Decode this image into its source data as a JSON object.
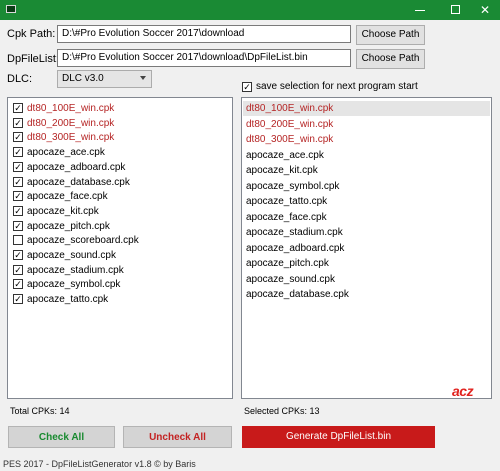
{
  "titlebar": {
    "minimize": "—",
    "maximize": "□",
    "close": "✕"
  },
  "cpk_path": {
    "label": "Cpk Path:",
    "value": "D:\\#Pro Evolution Soccer 2017\\download",
    "button": "Choose Path"
  },
  "dpfilelist": {
    "label": "DpFileList:",
    "value": "D:\\#Pro Evolution Soccer 2017\\download\\DpFileList.bin",
    "button": "Choose Path"
  },
  "dlc": {
    "label": "DLC:",
    "selected": "DLC v3.0"
  },
  "save_selection": {
    "label": "save selection for next program start",
    "checked": true
  },
  "left_list": [
    {
      "name": "dt80_100E_win.cpk",
      "checked": "✓",
      "red": true
    },
    {
      "name": "dt80_200E_win.cpk",
      "checked": "✓",
      "red": true
    },
    {
      "name": "dt80_300E_win.cpk",
      "checked": "✓",
      "red": true
    },
    {
      "name": "apocaze_ace.cpk",
      "checked": "✓",
      "red": false
    },
    {
      "name": "apocaze_adboard.cpk",
      "checked": "✓",
      "red": false
    },
    {
      "name": "apocaze_database.cpk",
      "checked": "✓",
      "red": false
    },
    {
      "name": "apocaze_face.cpk",
      "checked": "✓",
      "red": false
    },
    {
      "name": "apocaze_kit.cpk",
      "checked": "✓",
      "red": false
    },
    {
      "name": "apocaze_pitch.cpk",
      "checked": "✓",
      "red": false
    },
    {
      "name": "apocaze_scoreboard.cpk",
      "checked": "",
      "red": false
    },
    {
      "name": "apocaze_sound.cpk",
      "checked": "✓",
      "red": false
    },
    {
      "name": "apocaze_stadium.cpk",
      "checked": "✓",
      "red": false
    },
    {
      "name": "apocaze_symbol.cpk",
      "checked": "✓",
      "red": false
    },
    {
      "name": "apocaze_tatto.cpk",
      "checked": "✓",
      "red": false
    }
  ],
  "right_list": [
    {
      "name": "dt80_100E_win.cpk",
      "red": true
    },
    {
      "name": "dt80_200E_win.cpk",
      "red": true
    },
    {
      "name": "dt80_300E_win.cpk",
      "red": true
    },
    {
      "name": "apocaze_ace.cpk",
      "red": false
    },
    {
      "name": "apocaze_kit.cpk",
      "red": false
    },
    {
      "name": "apocaze_symbol.cpk",
      "red": false
    },
    {
      "name": "apocaze_tatto.cpk",
      "red": false
    },
    {
      "name": "apocaze_face.cpk",
      "red": false
    },
    {
      "name": "apocaze_stadium.cpk",
      "red": false
    },
    {
      "name": "apocaze_adboard.cpk",
      "red": false
    },
    {
      "name": "apocaze_pitch.cpk",
      "red": false
    },
    {
      "name": "apocaze_sound.cpk",
      "red": false
    },
    {
      "name": "apocaze_database.cpk",
      "red": false
    }
  ],
  "logo": "acz",
  "stats": {
    "total": "Total CPKs: 14",
    "selected": "Selected CPKs: 13"
  },
  "buttons": {
    "check_all": "Check All",
    "uncheck_all": "Uncheck All",
    "generate": "Generate DpFileList.bin"
  },
  "footer": "PES 2017 - DpFileListGenerator v1.8 © by Baris",
  "colors": {
    "titlebar": "#1a8a34",
    "accent_red": "#c81a1a",
    "list_red": "#b52525",
    "check_green": "#188a2f"
  }
}
